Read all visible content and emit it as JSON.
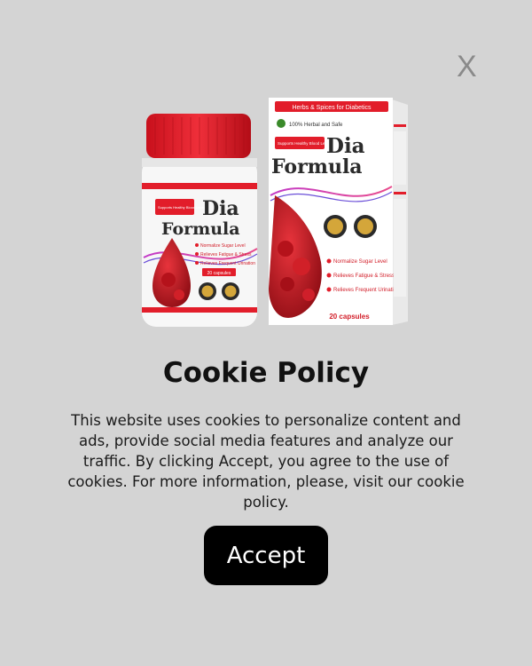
{
  "dialog": {
    "close_label": "X",
    "title": "Cookie Policy",
    "description": "This website uses cookies to personalize content and ads, provide social media features and analyze our traffic. By clicking Accept, you agree to the use of cookies. For more information, please, visit our cookie policy.",
    "accept_label": "Accept"
  },
  "product": {
    "jar_tagline": "Supports Healthy Blood Level",
    "jar_name_1": "Dia",
    "jar_name_2": "Formula",
    "jar_benefits": [
      "Normalize Sugar Level",
      "Relieves Fatigue & Stress",
      "Relieves Frequent Urination"
    ],
    "jar_count": "20 capsules",
    "box_banner": "Herbs & Spices for Diabetics",
    "box_herbal": "100% Herbal and Safe",
    "box_tagline": "Supports Healthy Blood Level",
    "box_name_1": "Dia",
    "box_name_2": "Formula",
    "box_benefits": [
      "Normalize Sugar Level",
      "Relieves Fatigue & Stress",
      "Relieves Frequent Urination"
    ],
    "box_count": "20 capsules"
  },
  "colors": {
    "background": "#d4d4d4",
    "brand_red": "#e21d2a",
    "button": "#000000"
  }
}
